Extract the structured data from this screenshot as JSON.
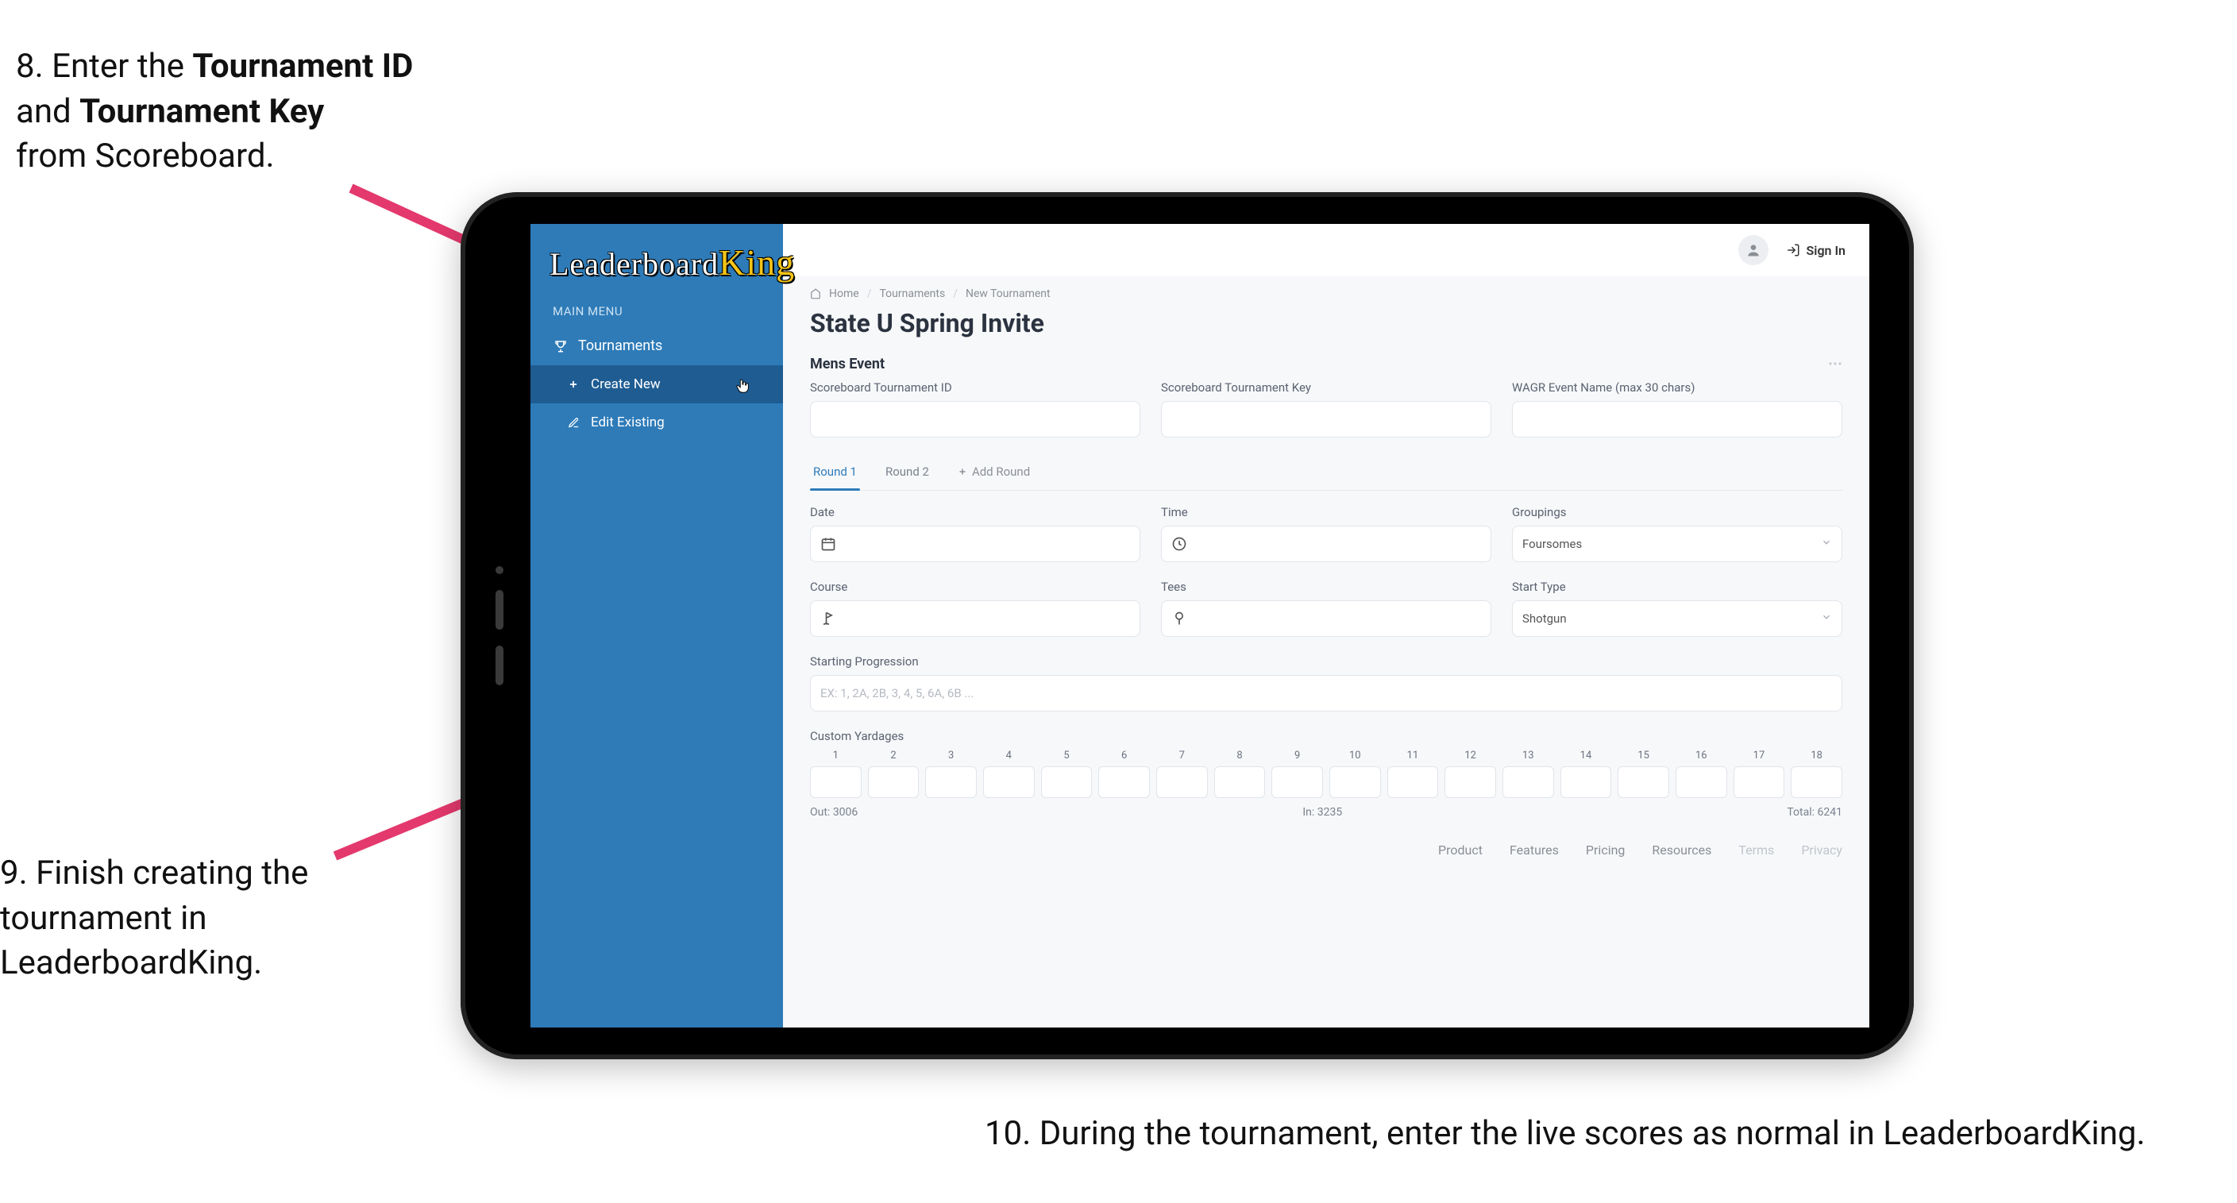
{
  "callouts": {
    "step8": {
      "prefix": "8. Enter the ",
      "bold1": "Tournament ID",
      "mid": "and ",
      "bold2": "Tournament Key",
      "suffix": "from Scoreboard."
    },
    "step9": "9. Finish creating the tournament in LeaderboardKing.",
    "step10": "10. During the tournament, enter the live scores as normal in LeaderboardKing."
  },
  "sidebar": {
    "logo_part1": "Leaderboard",
    "logo_part2": "King",
    "section_label": "MAIN MENU",
    "items": [
      {
        "icon": "trophy-icon",
        "label": "Tournaments"
      },
      {
        "icon": "plus-icon",
        "label": "Create New",
        "sub": true,
        "active": true
      },
      {
        "icon": "edit-icon",
        "label": "Edit Existing",
        "sub": true
      }
    ]
  },
  "topbar": {
    "sign_in": "Sign In"
  },
  "breadcrumb": {
    "home": "Home",
    "tournaments": "Tournaments",
    "newtournament": "New Tournament"
  },
  "page": {
    "title": "State U Spring Invite",
    "section": "Mens Event"
  },
  "idrow": {
    "tid_label": "Scoreboard Tournament ID",
    "tkey_label": "Scoreboard Tournament Key",
    "wagr_label": "WAGR Event Name (max 30 chars)"
  },
  "tabs": {
    "round1": "Round 1",
    "round2": "Round 2",
    "add": "Add Round"
  },
  "round": {
    "date_label": "Date",
    "time_label": "Time",
    "groupings_label": "Groupings",
    "groupings_value": "Foursomes",
    "course_label": "Course",
    "tees_label": "Tees",
    "starttype_label": "Start Type",
    "starttype_value": "Shotgun"
  },
  "starting": {
    "label": "Starting Progression",
    "placeholder": "EX: 1, 2A, 2B, 3, 4, 5, 6A, 6B ..."
  },
  "custom": {
    "label": "Custom Yardages",
    "holes": [
      "1",
      "2",
      "3",
      "4",
      "5",
      "6",
      "7",
      "8",
      "9",
      "10",
      "11",
      "12",
      "13",
      "14",
      "15",
      "16",
      "17",
      "18"
    ],
    "out_label": "Out:",
    "out_value": "3006",
    "in_label": "In:",
    "in_value": "3235",
    "total_label": "Total:",
    "total_value": "6241"
  },
  "footer": {
    "product": "Product",
    "features": "Features",
    "pricing": "Pricing",
    "resources": "Resources",
    "terms": "Terms",
    "privacy": "Privacy"
  }
}
